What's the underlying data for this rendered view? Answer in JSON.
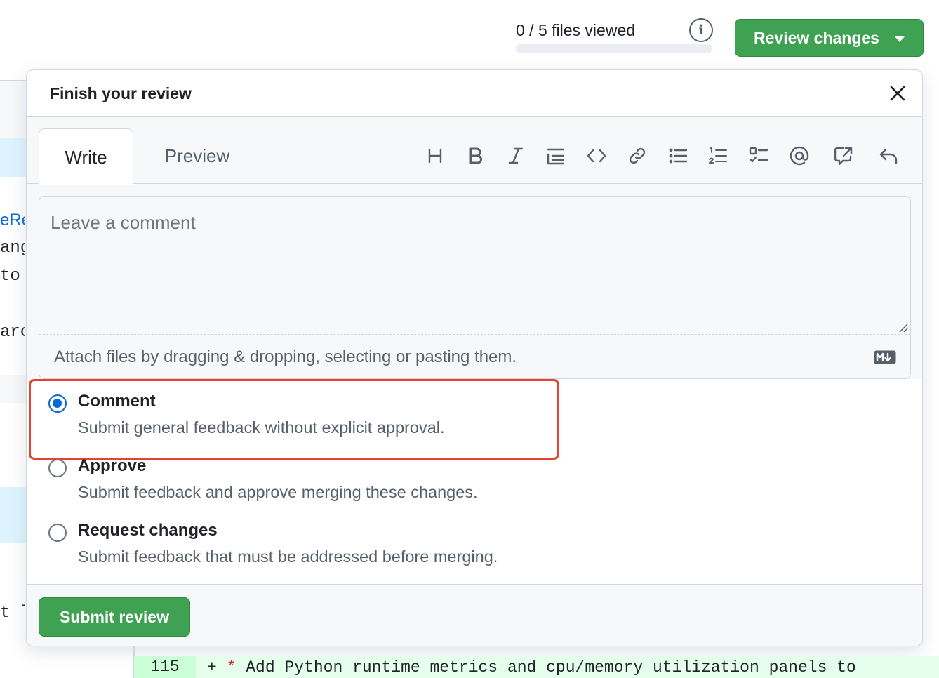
{
  "header": {
    "files_viewed": "0 / 5 files viewed",
    "files_viewed_progress": 0,
    "review_button_label": "Review changes"
  },
  "background": {
    "code_fragments": [
      "eRe",
      "ang",
      " to",
      "arc",
      "t l"
    ]
  },
  "modal": {
    "title": "Finish your review",
    "tabs": [
      {
        "label": "Write",
        "active": true
      },
      {
        "label": "Preview",
        "active": false
      }
    ],
    "toolbar_icons": [
      "heading-icon",
      "bold-icon",
      "italic-icon",
      "quote-icon",
      "code-icon",
      "link-icon",
      "unordered-list-icon",
      "ordered-list-icon",
      "task-list-icon",
      "mention-icon",
      "reference-icon",
      "reply-icon"
    ],
    "comment": {
      "placeholder": "Leave a comment",
      "value": ""
    },
    "attach_text": "Attach files by dragging & dropping, selecting or pasting them.",
    "options": [
      {
        "title": "Comment",
        "description": "Submit general feedback without explicit approval.",
        "checked": true
      },
      {
        "title": "Approve",
        "description": "Submit feedback and approve merging these changes.",
        "checked": false
      },
      {
        "title": "Request changes",
        "description": "Submit feedback that must be addressed before merging.",
        "checked": false
      }
    ],
    "submit_label": "Submit review"
  },
  "diff": {
    "line_number": "115",
    "marker": "+",
    "bullet": "*",
    "text": "Add Python runtime metrics and cpu/memory utilization panels to"
  },
  "colors": {
    "primary_green": "#3fa152",
    "accent_blue": "#0969da",
    "highlight_red": "#e0452e",
    "diff_added_bg": "#e6ffec"
  }
}
